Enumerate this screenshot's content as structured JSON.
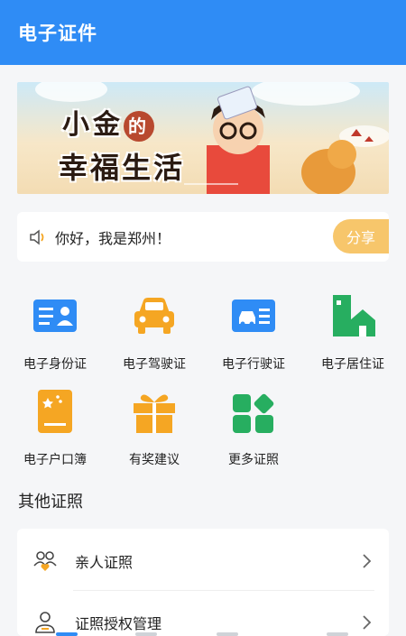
{
  "header": {
    "title": "电子证件"
  },
  "banner": {
    "line1_a": "小金",
    "line1_de": "的",
    "line2": "幸福生活"
  },
  "notice": {
    "text": "你好，我是郑州！",
    "share_label": "分享"
  },
  "services": [
    {
      "label": "电子身份证",
      "icon": "id-card-icon",
      "color": "#2f8cf5"
    },
    {
      "label": "电子驾驶证",
      "icon": "car-icon",
      "color": "#f5a623"
    },
    {
      "label": "电子行驶证",
      "icon": "vehicle-license-icon",
      "color": "#2f8cf5"
    },
    {
      "label": "电子居住证",
      "icon": "residence-icon",
      "color": "#27ae60"
    },
    {
      "label": "电子户口簿",
      "icon": "household-book-icon",
      "color": "#f5a623"
    },
    {
      "label": "有奖建议",
      "icon": "gift-icon",
      "color": "#f5a623"
    },
    {
      "label": "更多证照",
      "icon": "more-grid-icon",
      "color": "#27ae60"
    }
  ],
  "other": {
    "title": "其他证照",
    "items": [
      {
        "label": "亲人证照",
        "icon": "family-icon"
      },
      {
        "label": "证照授权管理",
        "icon": "authorization-icon"
      }
    ]
  }
}
